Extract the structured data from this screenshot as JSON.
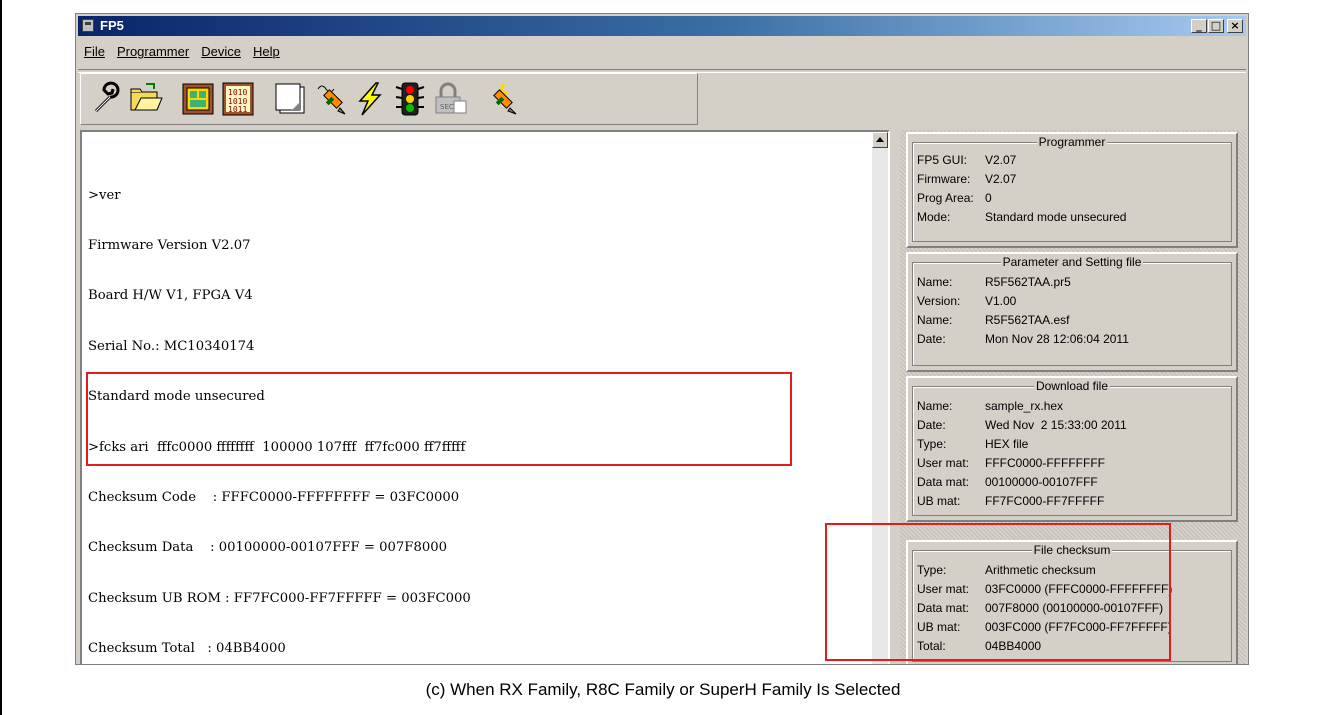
{
  "window": {
    "title": "FP5",
    "min_label": "_",
    "max_label": "□",
    "close_label": "×"
  },
  "menu": [
    "File",
    "Programmer",
    "Device",
    "Help"
  ],
  "toolbar_icons": [
    "wrench-icon",
    "folder-open-icon",
    "device-select-icon",
    "binary-data-icon",
    "blank-page-icon",
    "pen-chip-icon",
    "lightning-icon",
    "traffic-light-icon",
    "lock-icon",
    "erase-pen-icon"
  ],
  "console": {
    "lines": [
      ">ver",
      "Firmware Version V2.07",
      "Board H/W V1, FPGA V4",
      "Serial No.: MC10340174",
      "Standard mode unsecured",
      ">fcks ari  fffc0000 ffffffff  100000 107fff  ff7fc000 ff7fffff",
      "Checksum Code    : FFFC0000-FFFFFFFF = 03FC0000",
      "Checksum Data    : 00100000-00107FFF = 007F8000",
      "Checksum UB ROM : FF7FC000-FF7FFFFF = 003FC000",
      "Checksum Total   : 04BB4000",
      ">"
    ]
  },
  "programmer": {
    "title": "Programmer",
    "rows": [
      {
        "label": "FP5 GUI:",
        "value": "V2.07"
      },
      {
        "label": "Firmware:",
        "value": "V2.07"
      },
      {
        "label": "Prog Area:",
        "value": "0"
      },
      {
        "label": "Mode:",
        "value": "Standard mode unsecured"
      }
    ]
  },
  "param_file": {
    "title": "Parameter and Setting file",
    "rows": [
      {
        "label": "Name:",
        "value": "R5F562TAA.pr5"
      },
      {
        "label": "Version:",
        "value": "V1.00"
      },
      {
        "label": "Name:",
        "value": "R5F562TAA.esf"
      },
      {
        "label": "Date:",
        "value": "Mon Nov 28 12:06:04 2011"
      }
    ]
  },
  "download_file": {
    "title": "Download file",
    "rows": [
      {
        "label": "Name:",
        "value": "sample_rx.hex"
      },
      {
        "label": "Date:",
        "value": "Wed Nov  2 15:33:00 2011"
      },
      {
        "label": "Type:",
        "value": "HEX file"
      },
      {
        "label": "User mat:",
        "value": "FFFC0000-FFFFFFFF"
      },
      {
        "label": "Data mat:",
        "value": "00100000-00107FFF"
      },
      {
        "label": "UB mat:",
        "value": "FF7FC000-FF7FFFFF"
      }
    ]
  },
  "file_checksum": {
    "title": "File checksum",
    "rows": [
      {
        "label": "Type:",
        "value": "Arithmetic checksum"
      },
      {
        "label": "User mat:",
        "value": "03FC0000 (FFFC0000-FFFFFFFF)"
      },
      {
        "label": "Data mat:",
        "value": "007F8000 (00100000-00107FFF)"
      },
      {
        "label": "UB mat:",
        "value": "003FC000 (FF7FC000-FF7FFFFF)"
      },
      {
        "label": "Total:",
        "value": "04BB4000"
      }
    ]
  },
  "caption": "(c) When RX Family, R8C Family or SuperH Family Is Selected",
  "colors": {
    "highlight": "#e01c1c",
    "titlebar": "#0a246a",
    "window_face": "#d4d0c8"
  }
}
